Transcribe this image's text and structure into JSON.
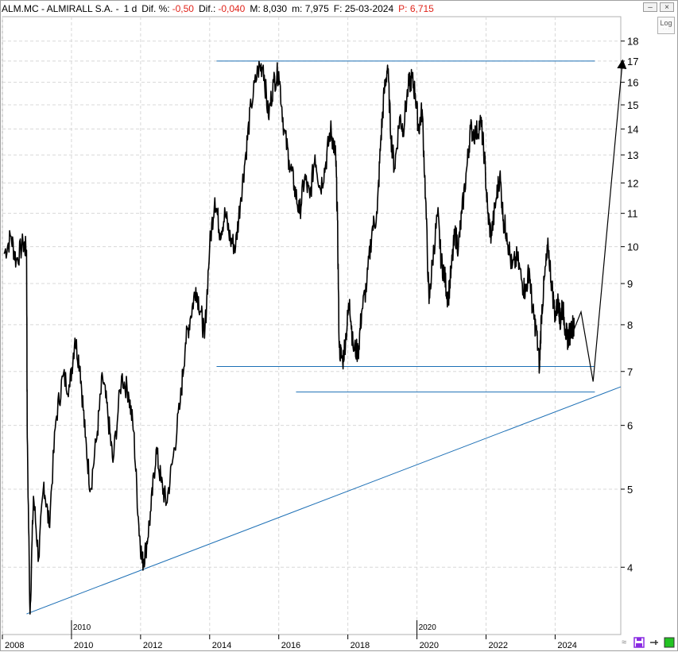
{
  "header": {
    "symbol": "ALM.MC - ALMIRALL S.A. -",
    "interval": "1 d",
    "dif_pct_label": "Dif. %:",
    "dif_pct_value": "-0,50",
    "dif_label": "Dif.:",
    "dif_value": "-0,040",
    "max_label": "M: 8,030",
    "min_label": "m: 7,975",
    "date_label": "F: 25-03-2024",
    "price_label": "P: 6,715"
  },
  "log_button": {
    "label": "Log"
  },
  "colors": {
    "price": "#000000",
    "trendlines": "#1c6fb5",
    "grid": "#d8d8d8",
    "accent_red": "#e0241b",
    "save_icon": "#8a2be2",
    "green_square": "#22c322"
  },
  "chart_data": {
    "type": "line",
    "title": "ALM.MC - ALMIRALL S.A.",
    "scale": "log",
    "ylim": [
      3.3,
      19.3
    ],
    "xlim": [
      2008.0,
      2025.9
    ],
    "yticks": [
      4,
      5,
      6,
      7,
      8,
      9,
      10,
      11,
      12,
      13,
      14,
      15,
      16,
      17,
      18
    ],
    "xticks": [
      {
        "x": 2008,
        "label": "2008"
      },
      {
        "x": 2010,
        "label": "2010"
      },
      {
        "x": 2012,
        "label": "2012"
      },
      {
        "x": 2014,
        "label": "2014"
      },
      {
        "x": 2016,
        "label": "2016"
      },
      {
        "x": 2018,
        "label": "2018"
      },
      {
        "x": 2020,
        "label": "2020"
      },
      {
        "x": 2022,
        "label": "2022"
      },
      {
        "x": 2024,
        "label": "2024"
      }
    ],
    "decade_markers": [
      {
        "x": 2010,
        "label": "2010"
      },
      {
        "x": 2020,
        "label": "2020"
      }
    ],
    "grid": true,
    "series": [
      {
        "values": [
          [
            2008.05,
            9.8
          ],
          [
            2008.25,
            10.3
          ],
          [
            2008.4,
            9.6
          ],
          [
            2008.6,
            10.1
          ],
          [
            2008.7,
            9.9
          ],
          [
            2008.72,
            5.8
          ],
          [
            2008.8,
            3.5
          ],
          [
            2008.9,
            4.9
          ],
          [
            2009.05,
            4.1
          ],
          [
            2009.2,
            5.1
          ],
          [
            2009.35,
            4.5
          ],
          [
            2009.55,
            6.1
          ],
          [
            2009.75,
            6.9
          ],
          [
            2009.95,
            6.7
          ],
          [
            2010.1,
            7.7
          ],
          [
            2010.25,
            7.1
          ],
          [
            2010.4,
            5.8
          ],
          [
            2010.55,
            5.0
          ],
          [
            2010.75,
            5.9
          ],
          [
            2010.9,
            6.9
          ],
          [
            2011.05,
            6.2
          ],
          [
            2011.2,
            5.4
          ],
          [
            2011.45,
            6.9
          ],
          [
            2011.65,
            6.6
          ],
          [
            2011.8,
            5.9
          ],
          [
            2011.95,
            4.5
          ],
          [
            2012.05,
            4.05
          ],
          [
            2012.15,
            4.2
          ],
          [
            2012.3,
            4.7
          ],
          [
            2012.45,
            5.6
          ],
          [
            2012.6,
            5.1
          ],
          [
            2012.75,
            4.8
          ],
          [
            2012.95,
            5.5
          ],
          [
            2013.15,
            6.4
          ],
          [
            2013.3,
            7.6
          ],
          [
            2013.45,
            8.2
          ],
          [
            2013.6,
            8.9
          ],
          [
            2013.75,
            8.3
          ],
          [
            2013.85,
            7.7
          ],
          [
            2014.0,
            10.0
          ],
          [
            2014.15,
            11.5
          ],
          [
            2014.3,
            10.4
          ],
          [
            2014.45,
            11.0
          ],
          [
            2014.6,
            10.2
          ],
          [
            2014.75,
            10.0
          ],
          [
            2014.9,
            11.5
          ],
          [
            2015.05,
            13.1
          ],
          [
            2015.2,
            15.0
          ],
          [
            2015.4,
            16.6
          ],
          [
            2015.55,
            16.8
          ],
          [
            2015.7,
            14.5
          ],
          [
            2015.85,
            16.0
          ],
          [
            2016.0,
            16.5
          ],
          [
            2016.15,
            14.0
          ],
          [
            2016.3,
            12.8
          ],
          [
            2016.45,
            11.9
          ],
          [
            2016.6,
            11.0
          ],
          [
            2016.75,
            12.2
          ],
          [
            2016.9,
            11.5
          ],
          [
            2017.05,
            13.0
          ],
          [
            2017.2,
            11.8
          ],
          [
            2017.35,
            12.6
          ],
          [
            2017.5,
            14.0
          ],
          [
            2017.6,
            13.3
          ],
          [
            2017.65,
            12.9
          ],
          [
            2017.7,
            10.8
          ],
          [
            2017.75,
            7.5
          ],
          [
            2017.85,
            7.2
          ],
          [
            2017.95,
            7.8
          ],
          [
            2018.05,
            8.6
          ],
          [
            2018.15,
            7.5
          ],
          [
            2018.3,
            7.4
          ],
          [
            2018.4,
            8.3
          ],
          [
            2018.55,
            9.0
          ],
          [
            2018.7,
            10.5
          ],
          [
            2018.85,
            11.0
          ],
          [
            2018.95,
            13.5
          ],
          [
            2019.05,
            15.5
          ],
          [
            2019.15,
            16.8
          ],
          [
            2019.25,
            13.7
          ],
          [
            2019.35,
            12.5
          ],
          [
            2019.5,
            14.5
          ],
          [
            2019.6,
            14.0
          ],
          [
            2019.75,
            15.8
          ],
          [
            2019.85,
            16.2
          ],
          [
            2019.95,
            15.5
          ],
          [
            2020.05,
            14.0
          ],
          [
            2020.15,
            14.8
          ],
          [
            2020.25,
            11.5
          ],
          [
            2020.35,
            8.5
          ],
          [
            2020.45,
            9.6
          ],
          [
            2020.6,
            11.0
          ],
          [
            2020.7,
            9.6
          ],
          [
            2020.8,
            9.2
          ],
          [
            2020.9,
            8.6
          ],
          [
            2021.0,
            9.4
          ],
          [
            2021.1,
            10.4
          ],
          [
            2021.2,
            10.0
          ],
          [
            2021.3,
            11.0
          ],
          [
            2021.45,
            12.6
          ],
          [
            2021.55,
            14.0
          ],
          [
            2021.7,
            13.8
          ],
          [
            2021.85,
            14.3
          ],
          [
            2021.95,
            13.0
          ],
          [
            2022.05,
            11.0
          ],
          [
            2022.15,
            10.3
          ],
          [
            2022.3,
            11.5
          ],
          [
            2022.4,
            12.3
          ],
          [
            2022.5,
            10.8
          ],
          [
            2022.6,
            10.4
          ],
          [
            2022.75,
            9.4
          ],
          [
            2022.9,
            9.7
          ],
          [
            2023.05,
            9.0
          ],
          [
            2023.15,
            8.8
          ],
          [
            2023.25,
            9.4
          ],
          [
            2023.35,
            8.3
          ],
          [
            2023.45,
            7.9
          ],
          [
            2023.55,
            7.1
          ],
          [
            2023.6,
            8.2
          ],
          [
            2023.7,
            9.2
          ],
          [
            2023.8,
            10.0
          ],
          [
            2023.9,
            9.0
          ],
          [
            2024.0,
            8.2
          ],
          [
            2024.1,
            8.6
          ],
          [
            2024.15,
            8.0
          ],
          [
            2024.2,
            8.5
          ],
          [
            2024.3,
            7.9
          ],
          [
            2024.35,
            7.7
          ],
          [
            2024.4,
            7.75
          ],
          [
            2024.5,
            8.0
          ],
          [
            2024.55,
            7.9
          ]
        ]
      }
    ],
    "projection": [
      [
        2024.55,
        7.9
      ],
      [
        2024.75,
        8.3
      ],
      [
        2025.1,
        6.8
      ],
      [
        2025.95,
        17.0
      ]
    ],
    "horizontal_lines": [
      {
        "y": 17.0,
        "x1": 2014.2,
        "x2": 2025.15
      },
      {
        "y": 7.1,
        "x1": 2014.2,
        "x2": 2025.15
      },
      {
        "y": 6.6,
        "x1": 2016.5,
        "x2": 2025.15
      }
    ],
    "trendline": {
      "from": [
        2008.7,
        3.5
      ],
      "to": [
        2025.9,
        6.7
      ]
    }
  }
}
